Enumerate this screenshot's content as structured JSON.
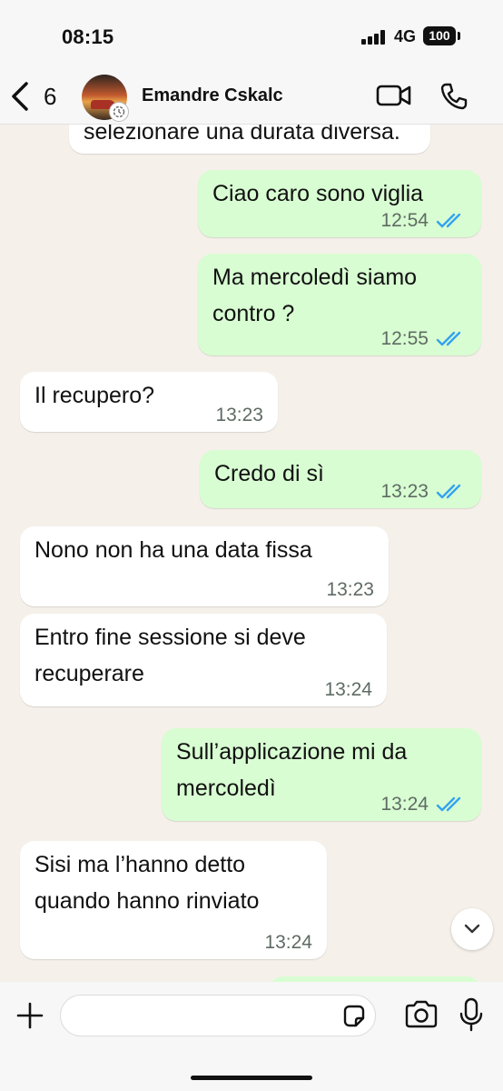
{
  "status_bar": {
    "time": "08:15",
    "network": "4G",
    "battery": "100"
  },
  "header": {
    "back_count": "6",
    "contact_name": "Emandre Cskalc"
  },
  "chat": {
    "previous_text": "selezionare una durata diversa.",
    "messages": [
      {
        "dir": "out",
        "lines": [
          "Ciao caro sono viglia"
        ],
        "time": "12:54",
        "read": true
      },
      {
        "dir": "out",
        "lines": [
          "Ma mercoledì siamo",
          "contro ?"
        ],
        "time": "12:55",
        "read": true
      },
      {
        "dir": "in",
        "lines": [
          "Il recupero?"
        ],
        "time": "13:23"
      },
      {
        "dir": "out",
        "lines": [
          "Credo di sì"
        ],
        "time": "13:23",
        "read": true
      },
      {
        "dir": "in",
        "lines": [
          "Nono non ha una data fissa"
        ],
        "time": "13:23"
      },
      {
        "dir": "in",
        "lines": [
          "Entro fine sessione si deve",
          "recuperare"
        ],
        "time": "13:24"
      },
      {
        "dir": "out",
        "lines": [
          "Sull’applicazione mi da",
          "mercoledì"
        ],
        "time": "13:24",
        "read": true
      },
      {
        "dir": "in",
        "lines": [
          "Sisi ma l’hanno detto",
          "quando hanno rinviato"
        ],
        "time": "13:24"
      }
    ]
  },
  "composer": {
    "value": "",
    "placeholder": ""
  },
  "colors": {
    "incoming": "#ffffff",
    "outgoing": "#d8fdd2",
    "read_ticks": "#34a3f0",
    "wallpaper": "#f5f1ea"
  },
  "icons": {
    "back": "chevron-left-icon",
    "video": "video-camera-icon",
    "phone": "phone-icon",
    "plus": "plus-icon",
    "sticker": "sticker-icon",
    "camera": "camera-icon",
    "mic": "microphone-icon",
    "scroll": "chevron-down-icon",
    "ticks": "double-check-icon"
  }
}
